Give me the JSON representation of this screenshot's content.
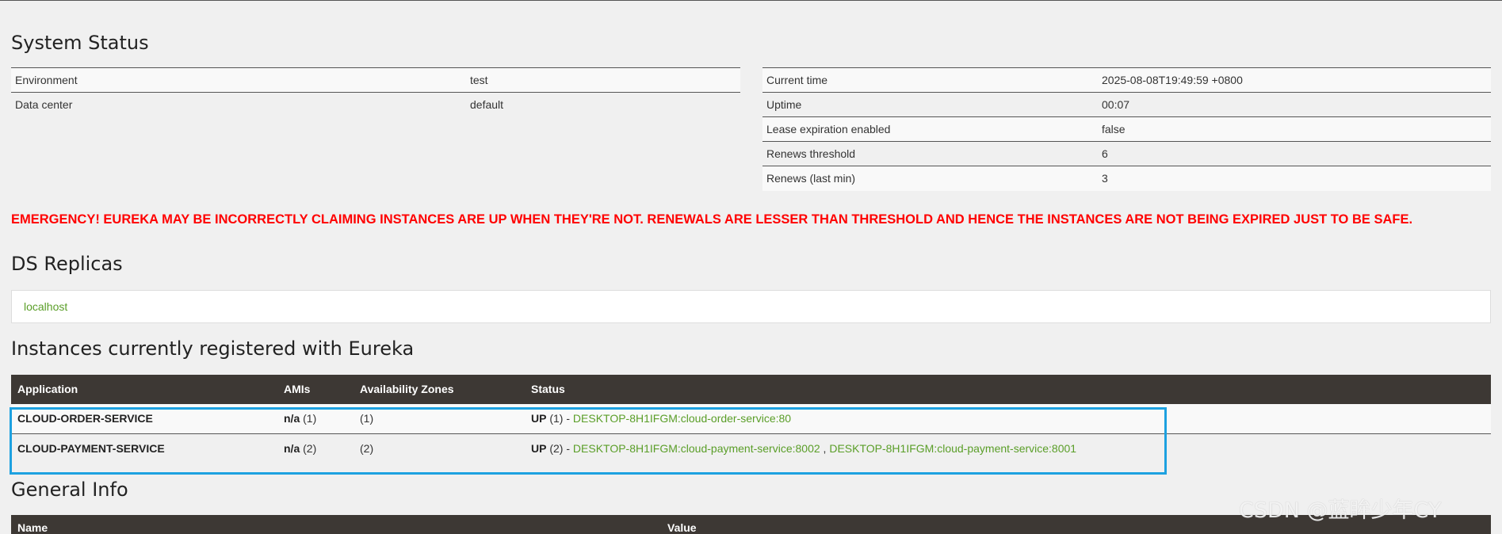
{
  "headings": {
    "system_status": "System Status",
    "ds_replicas": "DS Replicas",
    "instances": "Instances currently registered with Eureka",
    "general_info": "General Info"
  },
  "env_table": [
    {
      "key": "Environment",
      "value": "test"
    },
    {
      "key": "Data center",
      "value": "default"
    }
  ],
  "stats_table": [
    {
      "key": "Current time",
      "value": "2025-08-08T19:49:59 +0800"
    },
    {
      "key": "Uptime",
      "value": "00:07"
    },
    {
      "key": "Lease expiration enabled",
      "value": "false"
    },
    {
      "key": "Renews threshold",
      "value": "6"
    },
    {
      "key": "Renews (last min)",
      "value": "3"
    }
  ],
  "emergency": "EMERGENCY! EUREKA MAY BE INCORRECTLY CLAIMING INSTANCES ARE UP WHEN THEY'RE NOT. RENEWALS ARE LESSER THAN THRESHOLD AND HENCE THE INSTANCES ARE NOT BEING EXPIRED JUST TO BE SAFE.",
  "replicas": [
    "localhost"
  ],
  "instances": {
    "columns": [
      "Application",
      "AMIs",
      "Availability Zones",
      "Status"
    ],
    "rows": [
      {
        "application": "CLOUD-ORDER-SERVICE",
        "amis_label": "n/a",
        "amis_count": "(1)",
        "zones": "(1)",
        "status": "UP",
        "status_count": "(1) -",
        "links": [
          "DESKTOP-8H1IFGM:cloud-order-service:80"
        ]
      },
      {
        "application": "CLOUD-PAYMENT-SERVICE",
        "amis_label": "n/a",
        "amis_count": "(2)",
        "zones": "(2)",
        "status": "UP",
        "status_count": "(2) -",
        "links": [
          "DESKTOP-8H1IFGM:cloud-payment-service:8002",
          "DESKTOP-8H1IFGM:cloud-payment-service:8001"
        ],
        "link_separator": ","
      }
    ]
  },
  "general_info": {
    "columns": [
      "Name",
      "Value"
    ]
  },
  "watermark": "CSDN @蓝眸少年CY",
  "colors": {
    "emergency": "#ff0000",
    "link": "#5a9e28",
    "header_bg": "#3d3834",
    "highlight": "#1da1e0"
  }
}
